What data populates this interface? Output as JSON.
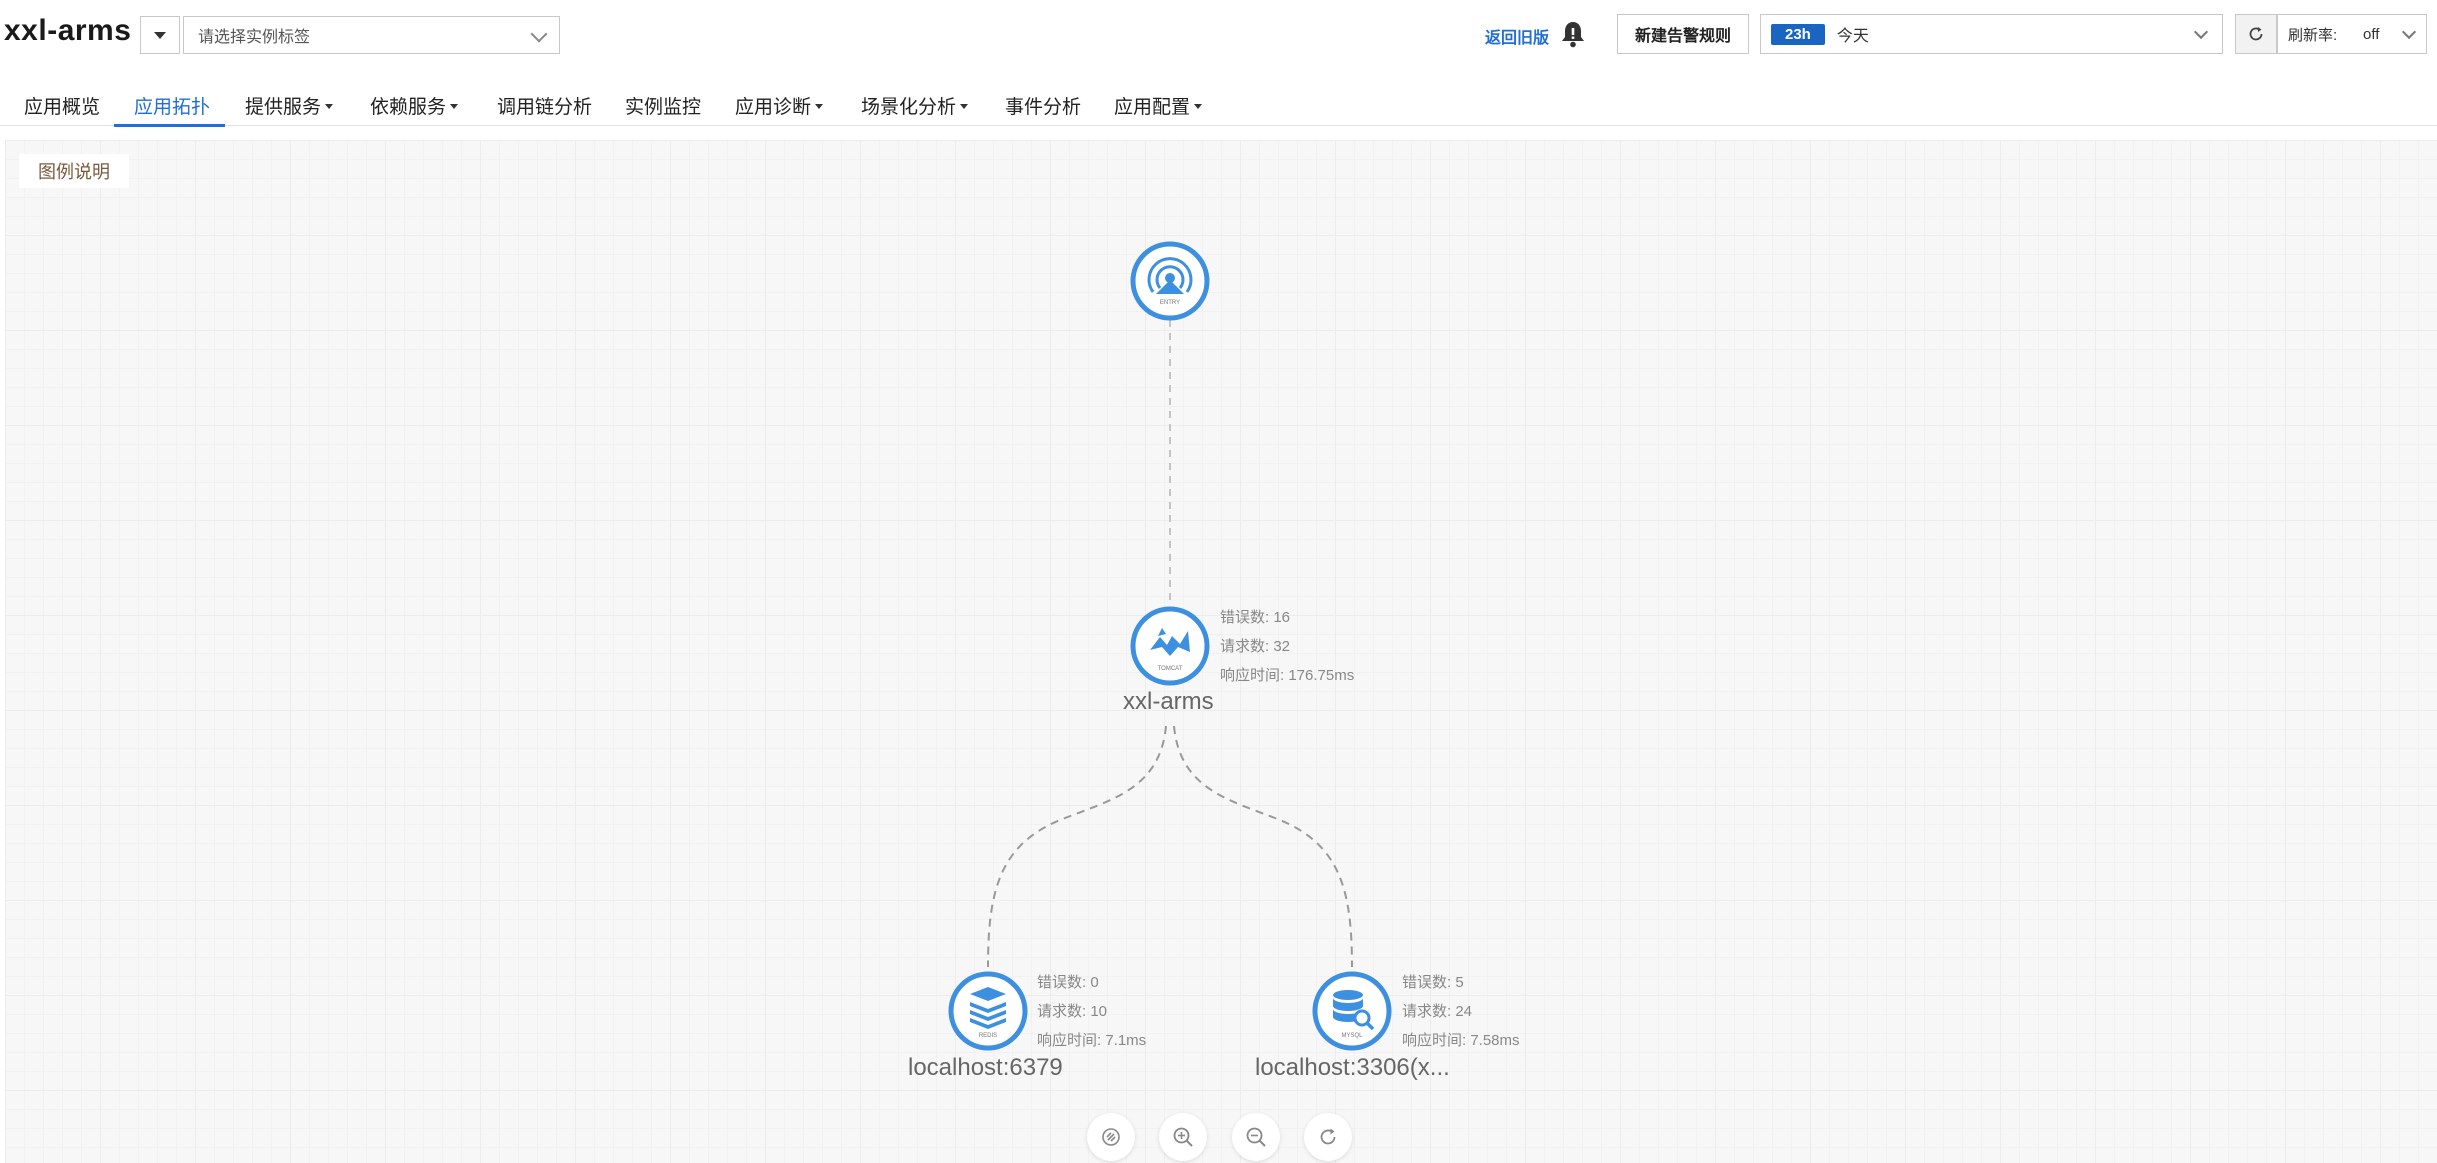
{
  "header": {
    "app_title": "xxl-arms",
    "tag_select_placeholder": "请选择实例标签",
    "old_version_link": "返回旧版",
    "new_alert_rule_button": "新建告警规则",
    "time_range": {
      "badge": "23h",
      "label": "今天"
    },
    "refresh_rate_label": "刷新率:",
    "refresh_rate_value": "off"
  },
  "tabs": [
    {
      "label": "应用概览",
      "active": false,
      "has_dropdown": false
    },
    {
      "label": "应用拓扑",
      "active": true,
      "has_dropdown": false
    },
    {
      "label": "提供服务",
      "active": false,
      "has_dropdown": true
    },
    {
      "label": "依赖服务",
      "active": false,
      "has_dropdown": true
    },
    {
      "label": "调用链分析",
      "active": false,
      "has_dropdown": false
    },
    {
      "label": "实例监控",
      "active": false,
      "has_dropdown": false
    },
    {
      "label": "应用诊断",
      "active": false,
      "has_dropdown": true
    },
    {
      "label": "场景化分析",
      "active": false,
      "has_dropdown": true
    },
    {
      "label": "事件分析",
      "active": false,
      "has_dropdown": false
    },
    {
      "label": "应用配置",
      "active": false,
      "has_dropdown": true
    }
  ],
  "topology": {
    "legend_button": "图例说明",
    "nodes": {
      "entry": {
        "icon": "entry-broadcast-icon",
        "icon_caption": "ENTRY"
      },
      "app": {
        "icon": "tomcat-icon",
        "icon_caption": "TOMCAT",
        "label": "xxl-arms",
        "errors": "错误数: 16",
        "requests": "请求数: 32",
        "response_time": "响应时间: 176.75ms"
      },
      "redis": {
        "icon": "redis-icon",
        "icon_caption": "REDIS",
        "label": "localhost:6379",
        "errors": "错误数: 0",
        "requests": "请求数: 10",
        "response_time": "响应时间: 7.1ms"
      },
      "mysql": {
        "icon": "mysql-icon",
        "icon_caption": "MYSQL",
        "label": "localhost:3306(x...",
        "errors": "错误数: 5",
        "requests": "请求数: 24",
        "response_time": "响应时间: 7.58ms"
      }
    }
  },
  "colors": {
    "accent": "#1f6fd6",
    "node_blue": "#3d8fe0",
    "badge_blue": "#1a65c2",
    "edge": "#aaaaaa"
  }
}
